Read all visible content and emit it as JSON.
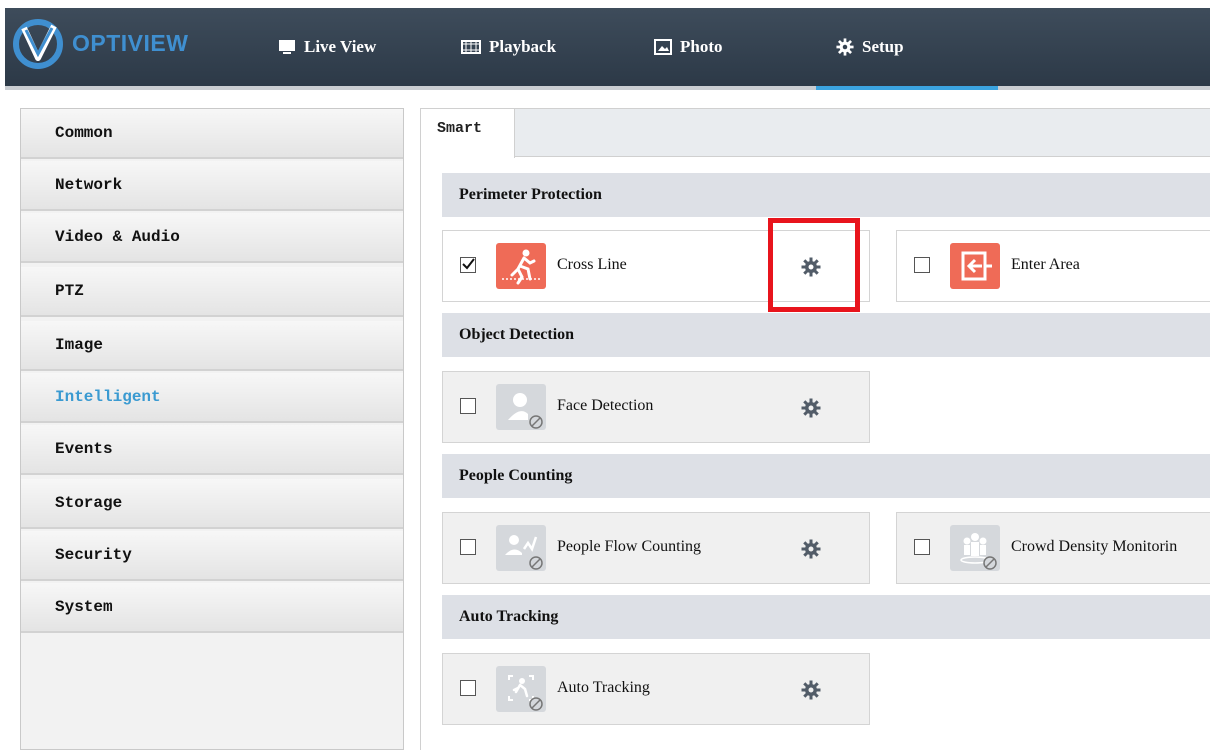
{
  "brand": {
    "name": "OPTIVIEW",
    "accent": "#3f8fd0"
  },
  "nav": [
    {
      "label": "Live View",
      "icon": "monitor-icon"
    },
    {
      "label": "Playback",
      "icon": "film-icon"
    },
    {
      "label": "Photo",
      "icon": "photo-icon"
    },
    {
      "label": "Setup",
      "icon": "gear-icon",
      "active": true
    }
  ],
  "sidebar": {
    "items": [
      {
        "label": "Common"
      },
      {
        "label": "Network"
      },
      {
        "label": "Video & Audio"
      },
      {
        "label": "PTZ"
      },
      {
        "label": "Image"
      },
      {
        "label": "Intelligent",
        "active": true
      },
      {
        "label": "Events"
      },
      {
        "label": "Storage"
      },
      {
        "label": "Security"
      },
      {
        "label": "System"
      }
    ],
    "active_color": "#3a9ad1"
  },
  "tabs": [
    {
      "label": "Smart",
      "active": true
    }
  ],
  "sections": [
    {
      "title": "Perimeter Protection",
      "features": [
        {
          "label": "Cross Line",
          "checked": true,
          "enabled": true,
          "icon": "cross-line-icon",
          "has_settings": true,
          "highlighted": true
        },
        {
          "label": "Enter Area",
          "checked": false,
          "enabled": true,
          "icon": "enter-area-icon",
          "has_settings": false
        }
      ]
    },
    {
      "title": "Object Detection",
      "features": [
        {
          "label": "Face Detection",
          "checked": false,
          "enabled": false,
          "icon": "face-detection-icon",
          "has_settings": true
        }
      ]
    },
    {
      "title": "People Counting",
      "features": [
        {
          "label": "People Flow Counting",
          "checked": false,
          "enabled": false,
          "icon": "people-flow-icon",
          "has_settings": true
        },
        {
          "label": "Crowd Density Monitorin",
          "checked": false,
          "enabled": false,
          "icon": "crowd-density-icon",
          "has_settings": false
        }
      ]
    },
    {
      "title": "Auto Tracking",
      "features": [
        {
          "label": "Auto Tracking",
          "checked": false,
          "enabled": false,
          "icon": "auto-tracking-icon",
          "has_settings": true
        }
      ]
    }
  ],
  "colors": {
    "header_bg": "#34414f",
    "feature_icon_active": "#ef6b57",
    "highlight_border": "#e8141c"
  }
}
